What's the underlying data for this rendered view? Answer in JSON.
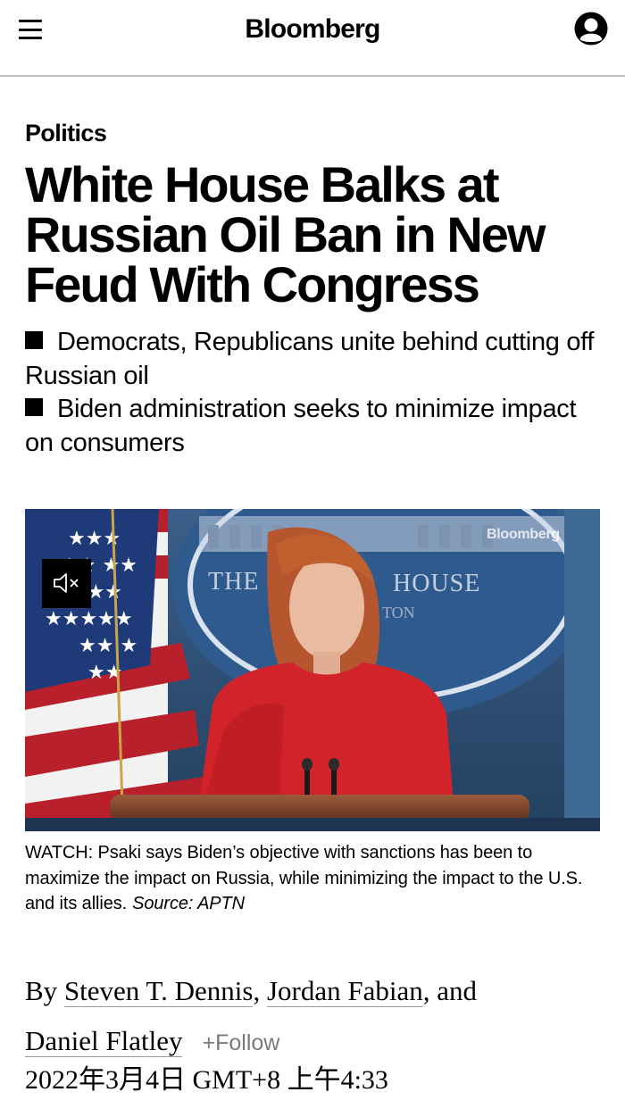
{
  "header": {
    "brand": "Bloomberg",
    "menu_icon": "hamburger-menu-icon",
    "account_icon": "user-account-icon"
  },
  "article": {
    "kicker": "Politics",
    "headline": "White House Balks at Russian Oil Ban in New Feud With Congress",
    "bullets": [
      "Democrats, Republicans unite behind cutting off Russian oil",
      "Biden administration seeks to minimize impact on consumers"
    ]
  },
  "video": {
    "watermark": "Bloomberg",
    "podium_sign": [
      "THE",
      "HOUSE",
      "TON"
    ],
    "mute_icon": "speaker-muted-icon",
    "caption": "WATCH: Psaki says Biden’s objective with sanctions has been to maximize the impact on Russia, while minimizing the impact to the U.S. and its allies.",
    "source": "Source: APTN"
  },
  "byline": {
    "prefix": "By",
    "authors": [
      "Steven T. Dennis",
      "Jordan Fabian",
      "Daniel Flatley"
    ],
    "sep1": ",",
    "sep2": ", and",
    "follow": "+Follow",
    "date": "2022年3月4日 GMT+8 上午4:33"
  },
  "colors": {
    "rule": "#bdbdbd",
    "follow": "#7a7a7a",
    "video_bg": "#2d4c73",
    "dress": "#d2232a"
  }
}
